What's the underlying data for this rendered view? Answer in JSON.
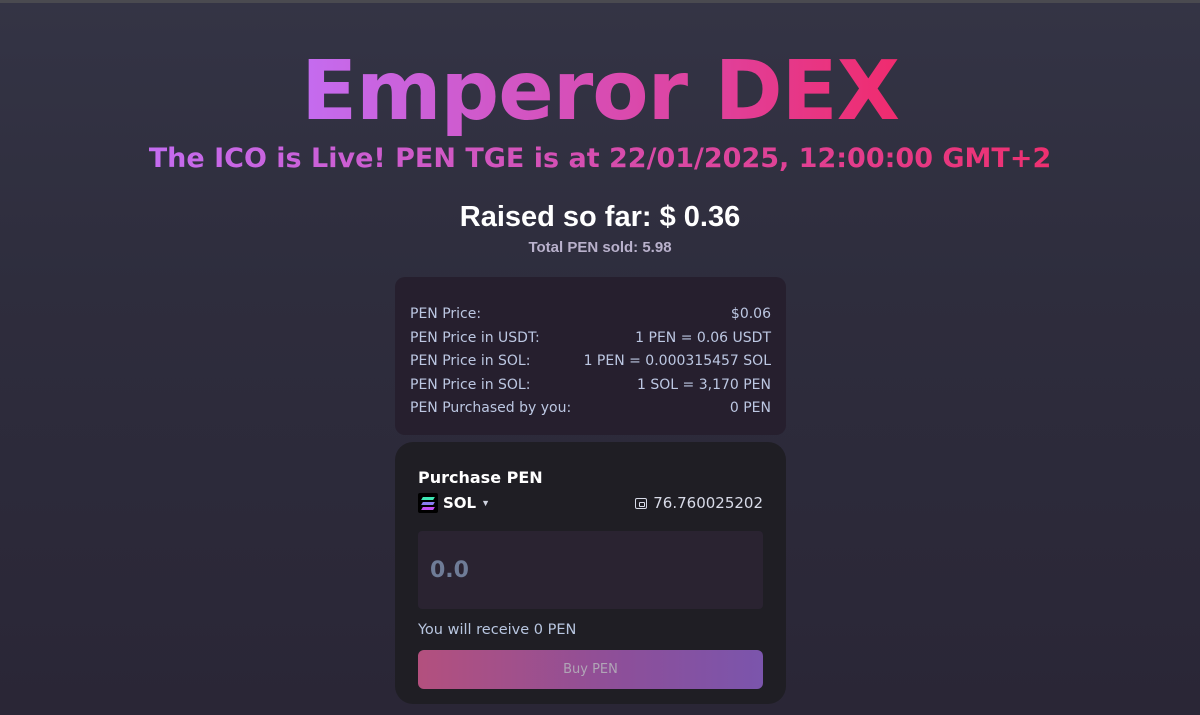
{
  "header": {
    "title": "Emperor DEX",
    "subtitle": "The ICO is Live! PEN TGE is at 22/01/2025, 12:00:00 GMT+2"
  },
  "stats": {
    "raised": "Raised so far: $ 0.36",
    "sold": "Total PEN sold: 5.98"
  },
  "info": {
    "rows": [
      {
        "label": "PEN Price:",
        "value": "$0.06"
      },
      {
        "label": "PEN Price in USDT:",
        "value": "1 PEN = 0.06 USDT"
      },
      {
        "label": "PEN Price in SOL:",
        "value": "1 PEN = 0.000315457 SOL"
      },
      {
        "label": "PEN Price in SOL:",
        "value": "1 SOL = 3,170 PEN"
      },
      {
        "label": "PEN Purchased by you:",
        "value": "0 PEN"
      }
    ]
  },
  "purchase": {
    "title": "Purchase PEN",
    "token": "SOL",
    "token_icon": "solana-logo-icon",
    "balance": "76.760025202",
    "balance_icon": "wallet-icon",
    "amount_placeholder": "0.0",
    "receive_text": "You will receive 0 PEN",
    "buy_label": "Buy PEN"
  },
  "colors": {
    "background": "#2f2e3e",
    "title_gradient_start": "#c46cf0",
    "title_gradient_end": "#f02b6e",
    "card_bg": "#261f2e",
    "buy_card_bg": "#1f1e24",
    "button_gradient_start": "#b3507e",
    "button_gradient_end": "#7b55ac"
  }
}
